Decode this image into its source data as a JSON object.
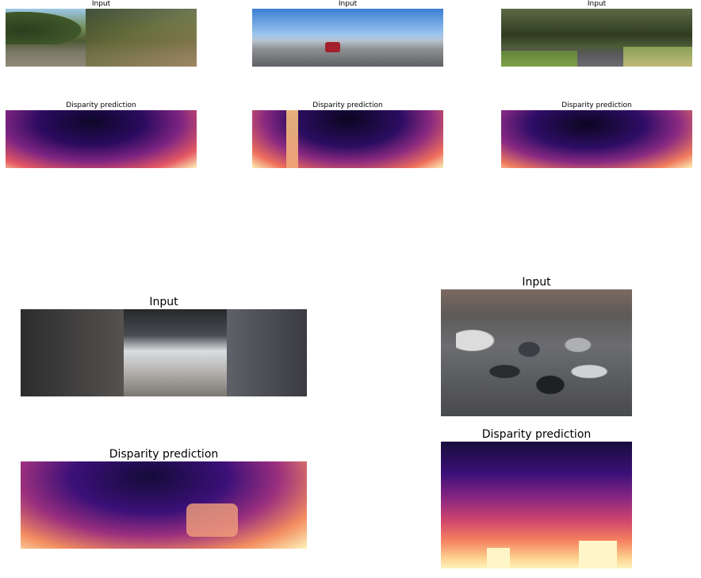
{
  "panels": {
    "input_title": "Input",
    "disparity_title": "Disparity prediction"
  }
}
